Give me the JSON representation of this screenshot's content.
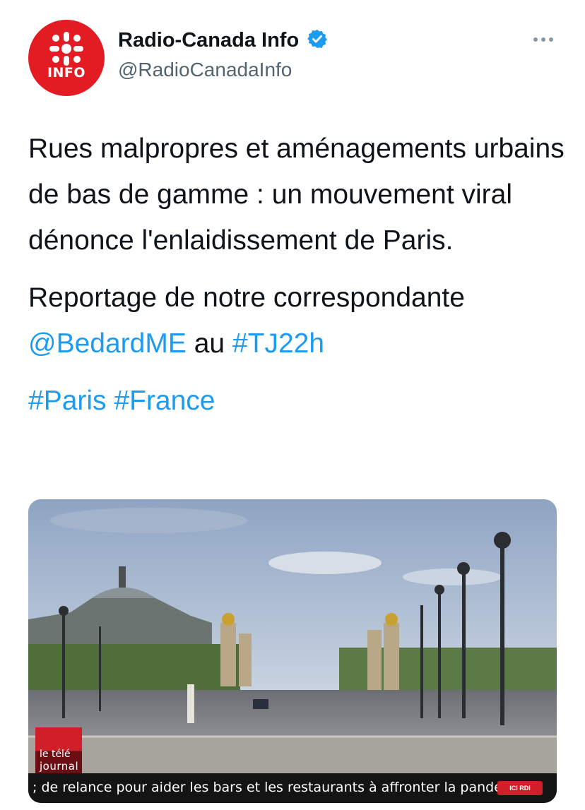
{
  "account": {
    "display_name": "Radio-Canada Info",
    "handle": "@RadioCanadaInfo",
    "avatar_text": "INFO",
    "verified": true
  },
  "tweet": {
    "line1": "Rues malpropres et aménagements urbains de bas de gamme : un mouvement viral dénonce l'enlaidissement de Paris.",
    "para2_text": "Reportage de notre correspondante",
    "mention": "@BedardME",
    "au": "au",
    "hashtag_tj": "#TJ22h",
    "hashtag_paris": "#Paris",
    "hashtag_france": "#France"
  },
  "media": {
    "logo_line1": "le télé",
    "logo_line2": "journal",
    "ticker": "; de relance pour aider les bars et les restaurants à affronter la pandé",
    "channel_badge": "ICI RDI"
  },
  "icons": {
    "verified": "verified-badge-icon",
    "more": "more-options-icon",
    "avatar_logo": "radio-canada-gem-icon"
  },
  "colors": {
    "link": "#1d9bf0",
    "brand_red": "#e31b23",
    "text": "#0f1419",
    "secondary": "#536471"
  }
}
